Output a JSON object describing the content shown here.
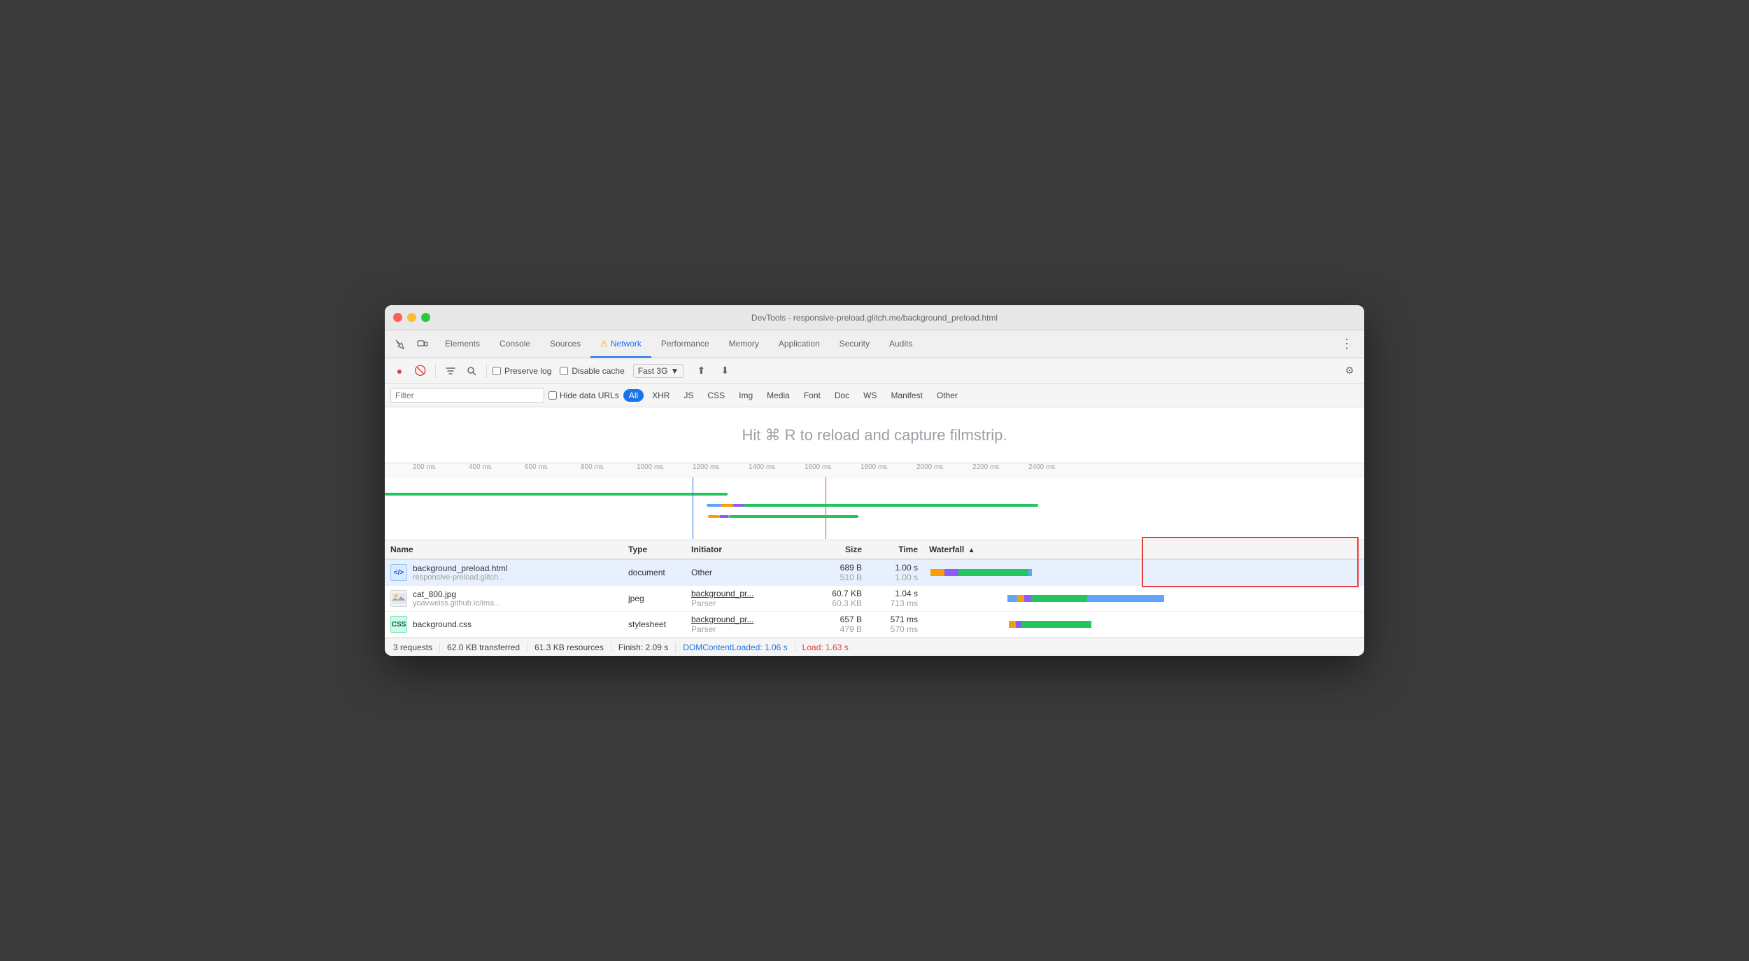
{
  "window": {
    "title": "DevTools - responsive-preload.glitch.me/background_preload.html"
  },
  "tabs": [
    {
      "id": "elements",
      "label": "Elements",
      "active": false
    },
    {
      "id": "console",
      "label": "Console",
      "active": false
    },
    {
      "id": "sources",
      "label": "Sources",
      "active": false
    },
    {
      "id": "network",
      "label": "Network",
      "active": true,
      "warning": true
    },
    {
      "id": "performance",
      "label": "Performance",
      "active": false
    },
    {
      "id": "memory",
      "label": "Memory",
      "active": false
    },
    {
      "id": "application",
      "label": "Application",
      "active": false
    },
    {
      "id": "security",
      "label": "Security",
      "active": false
    },
    {
      "id": "audits",
      "label": "Audits",
      "active": false
    }
  ],
  "toolbar": {
    "record_label": "●",
    "clear_label": "🚫",
    "filter_label": "▼",
    "search_label": "🔍",
    "preserve_log": "Preserve log",
    "disable_cache": "Disable cache",
    "throttle": "Fast 3G",
    "upload_label": "⬆",
    "download_label": "⬇",
    "settings_label": "⚙"
  },
  "filter": {
    "placeholder": "Filter",
    "hide_data_urls": "Hide data URLs",
    "chips": [
      "All",
      "XHR",
      "JS",
      "CSS",
      "Img",
      "Media",
      "Font",
      "Doc",
      "WS",
      "Manifest",
      "Other"
    ]
  },
  "filmstrip": {
    "hint": "Hit ⌘ R to reload and capture filmstrip."
  },
  "timeline": {
    "ticks": [
      "200 ms",
      "400 ms",
      "600 ms",
      "800 ms",
      "1000 ms",
      "1200 ms",
      "1400 ms",
      "1600 ms",
      "1800 ms",
      "2000 ms",
      "2200 ms",
      "2400 ms"
    ]
  },
  "table": {
    "headers": {
      "name": "Name",
      "type": "Type",
      "initiator": "Initiator",
      "size": "Size",
      "time": "Time",
      "waterfall": "Waterfall"
    },
    "rows": [
      {
        "id": "row1",
        "icon_type": "html",
        "icon_text": "</>",
        "name": "background_preload.html",
        "name_sub": "responsive-preload.glitch...",
        "type": "document",
        "initiator": "Other",
        "initiator_link": false,
        "size": "689 B",
        "size_sub": "510 B",
        "time": "1.00 s",
        "time_sub": "1.00 s",
        "selected": true
      },
      {
        "id": "row2",
        "icon_type": "jpg",
        "name": "cat_800.jpg",
        "name_sub": "yoavweiss.github.io/ima...",
        "type": "jpeg",
        "initiator": "background_pr...",
        "initiator_sub": "Parser",
        "initiator_link": true,
        "size": "60.7 KB",
        "size_sub": "60.3 KB",
        "time": "1.04 s",
        "time_sub": "713 ms",
        "selected": false
      },
      {
        "id": "row3",
        "icon_type": "css",
        "icon_text": "CSS",
        "name": "background.css",
        "name_sub": "",
        "type": "stylesheet",
        "initiator": "background_pr...",
        "initiator_sub": "Parser",
        "initiator_link": true,
        "size": "657 B",
        "size_sub": "479 B",
        "time": "571 ms",
        "time_sub": "570 ms",
        "selected": false
      }
    ]
  },
  "statusbar": {
    "requests": "3 requests",
    "transferred": "62.0 KB transferred",
    "resources": "61.3 KB resources",
    "finish": "Finish: 2.09 s",
    "dom_content": "DOMContentLoaded: 1.06 s",
    "load": "Load: 1.63 s"
  }
}
